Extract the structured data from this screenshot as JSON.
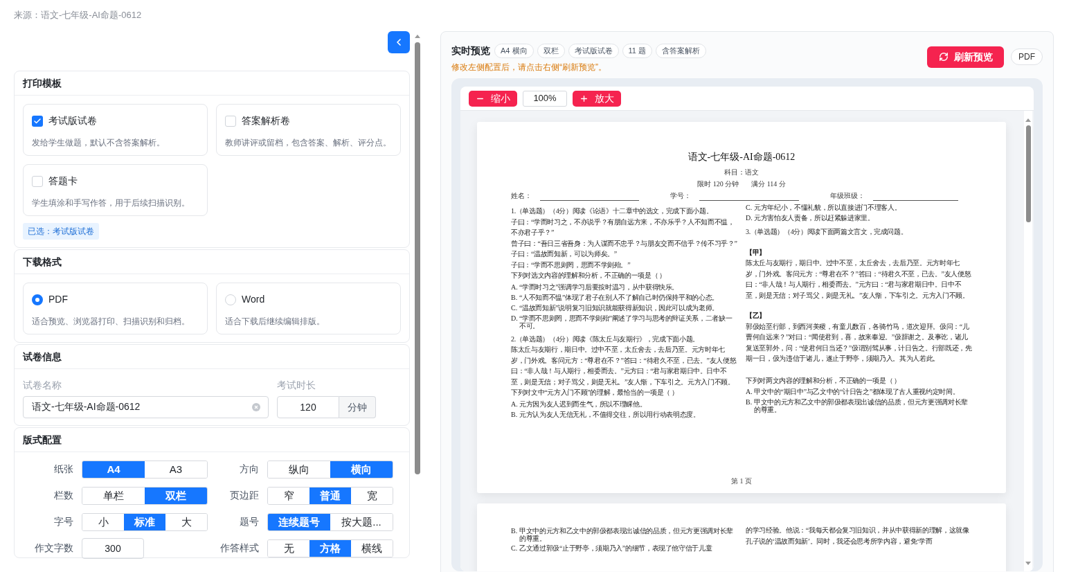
{
  "source": "来源：语文-七年级-AI命题-0612",
  "template": {
    "title": "打印模板",
    "options": [
      {
        "label": "考试版试卷",
        "desc": "发给学生做题，默认不含答案解析。",
        "checked": true
      },
      {
        "label": "答案解析卷",
        "desc": "教师讲评或留档，包含答案、解析、评分点。",
        "checked": false
      },
      {
        "label": "答题卡",
        "desc": "学生填涂和手写作答，用于后续扫描识别。",
        "checked": false
      }
    ],
    "note": "已选：考试版试卷"
  },
  "format": {
    "title": "下载格式",
    "options": [
      {
        "label": "PDF",
        "desc": "适合预览、浏览器打印、扫描识别和归档。",
        "selected": true
      },
      {
        "label": "Word",
        "desc": "适合下载后继续编辑排版。",
        "selected": false
      }
    ]
  },
  "info": {
    "title": "试卷信息",
    "name_label": "试卷名称",
    "name_value": "语文-七年级-AI命题-0612",
    "duration_label": "考试时长",
    "duration_value": "120",
    "duration_unit": "分钟"
  },
  "layout": {
    "title": "版式配置",
    "rows": [
      {
        "label": "纸张",
        "kind": "segmented",
        "options": [
          {
            "label": "A4",
            "selected": true
          },
          {
            "label": "A3",
            "selected": false
          }
        ]
      },
      {
        "label": "方向",
        "kind": "segmented",
        "options": [
          {
            "label": "纵向",
            "selected": false
          },
          {
            "label": "横向",
            "selected": true
          }
        ]
      },
      {
        "label": "栏数",
        "kind": "segmented",
        "options": [
          {
            "label": "单栏",
            "selected": false
          },
          {
            "label": "双栏",
            "selected": true
          }
        ]
      },
      {
        "label": "页边距",
        "kind": "segmented",
        "options": [
          {
            "label": "窄",
            "selected": false
          },
          {
            "label": "普通",
            "selected": true
          },
          {
            "label": "宽",
            "selected": false
          }
        ]
      },
      {
        "label": "字号",
        "kind": "segmented",
        "options": [
          {
            "label": "小",
            "selected": false
          },
          {
            "label": "标准",
            "selected": true
          },
          {
            "label": "大",
            "selected": false
          }
        ]
      },
      {
        "label": "题号",
        "kind": "segmented",
        "options": [
          {
            "label": "连续题号",
            "selected": true
          },
          {
            "label": "按大题...",
            "selected": false
          }
        ]
      },
      {
        "label": "作文字数",
        "kind": "input",
        "value": "300"
      },
      {
        "label": "作答样式",
        "kind": "segmented",
        "options": [
          {
            "label": "无",
            "selected": false
          },
          {
            "label": "方格",
            "selected": true
          },
          {
            "label": "横线",
            "selected": false
          }
        ]
      }
    ]
  },
  "preview": {
    "title": "实时预览",
    "chips": [
      "A4 横向",
      "双栏",
      "考试版试卷",
      "11 题",
      "含答案解析"
    ],
    "hint": "修改左侧配置后，请点击右侧“刷新预览”。",
    "refresh": "刷新预览",
    "pdf": "PDF",
    "zoom_out": "缩小",
    "zoom_value": "100%",
    "zoom_in": "放大",
    "pages": [
      {
        "title": "语文-七年级-AI命题-0612",
        "subject": "科目：语文",
        "time": "限时 120 分钟",
        "score": "满分 114 分",
        "fields": [
          "姓名：",
          "学号：",
          "年级班级："
        ],
        "footer": "第 1 页",
        "columns": [
          [
            {
              "kind": "question",
              "text": "1.（单选题）（4分）阅读《论语》十二章中的选文，完成下面小题。"
            },
            {
              "kind": "line",
              "text": "子曰：“学而时习之，不亦说乎？有朋自远方来，不亦乐乎？人不知而不愠，不亦君子乎？”"
            },
            {
              "kind": "line",
              "text": "曾子曰：“吾日三省吾身：为人谋而不忠乎？与朋友交而不信乎？传不习乎？”"
            },
            {
              "kind": "line",
              "text": "子曰：“温故而知新，可以为师矣。”"
            },
            {
              "kind": "line",
              "text": "子曰：“学而不思则罔，思而不学则殆。”"
            },
            {
              "kind": "line",
              "text": "下列对选文内容的理解和分析，不正确的一项是（ ）"
            },
            {
              "kind": "choice",
              "mark": "A.",
              "text": "“学而时习之”强调学习后要按时温习，从中获得快乐。"
            },
            {
              "kind": "choice",
              "mark": "B.",
              "text": "“人不知而不愠”体现了君子在别人不了解自己时仍保持平和的心态。"
            },
            {
              "kind": "choice",
              "mark": "C.",
              "text": "“温故而知新”说明复习旧知识就能获得新知识，因此可以成为老师。"
            },
            {
              "kind": "choice",
              "mark": "D.",
              "text": "“学而不思则罔，思而不学则殆”阐述了学习与思考的辩证关系，二者缺一不可。"
            },
            {
              "kind": "question",
              "text": "2.（单选题）（4分）阅读《陈太丘与友期行》，完成下面小题。"
            },
            {
              "kind": "line",
              "text": "陈太丘与友期行，期日中。过中不至，太丘舍去，去后乃至。元方时年七岁，门外戏。客问元方：“尊君在不？”答曰：“待君久不至，已去。”友人便怒曰：“非人哉！与人期行，相委而去。”元方曰：“君与家君期日中。日中不至，则是无信；对子骂父，则是无礼。”友人惭，下车引之。元方入门不顾。"
            },
            {
              "kind": "line",
              "text": "下列对文中“元方入门不顾”的理解，最恰当的一项是（ ）"
            },
            {
              "kind": "choice",
              "mark": "A.",
              "text": "元方因为友人迟到而生气，所以不理睬他。"
            },
            {
              "kind": "choice",
              "mark": "B.",
              "text": "元方认为友人无信无礼，不值得交往，所以用行动表明态度。"
            }
          ],
          [
            {
              "kind": "choice",
              "mark": "C.",
              "text": "元方年纪小，不懂礼貌，所以直接进门不理客人。"
            },
            {
              "kind": "choice",
              "mark": "D.",
              "text": "元方害怕友人责备，所以赶紧躲进家里。"
            },
            {
              "kind": "question",
              "text": "3.（单选题）（4分）阅读下面两篇文言文，完成问题。"
            },
            {
              "kind": "label",
              "text": "【甲】"
            },
            {
              "kind": "line",
              "text": "陈太丘与友期行，期日中。过中不至，太丘舍去，去后乃至。元方时年七岁，门外戏。客问元方：“尊君在不？”答曰：“待君久不至，已去。”友人便怒曰：“非人哉！与人期行，相委而去。”元方曰：“君与家君期日中。日中不至，则是无信；对子骂父，则是无礼。”友人惭，下车引之。元方入门不顾。"
            },
            {
              "kind": "label",
              "text": "【乙】"
            },
            {
              "kind": "line",
              "text": "郭伋始至行部，到西河美稷，有童儿数百，各骑竹马，道次迎拜。伋问：“儿曹何自远来？”对曰：“闻使君到，喜，故来奉迎。”伋辞谢之。及事讫，诸儿复送至郭外，问：“使君何日当还？”伋谓别驾从事，计日告之。行部既还，先期一日，伋为违信于诸儿，遂止于野亭，须期乃入。其为人若此。"
            },
            {
              "kind": "prompt",
              "text": "下列对两文内容的理解和分析，不正确的一项是（ ）"
            },
            {
              "kind": "choice",
              "mark": "A.",
              "text": "甲文中的“期日中”与乙文中的“计日告之”都体现了古人重视约定时间。"
            },
            {
              "kind": "choice",
              "mark": "B.",
              "text": "甲文中的元方和乙文中的郭伋都表现出诚信的品质，但元方更强调对长辈的尊重。"
            }
          ]
        ]
      },
      {
        "columns": [
          [
            {
              "kind": "choice",
              "mark": "B.",
              "text": "甲文中的元方和乙文中的郭伋都表现出诚信的品质，但元方更强调对长辈的尊重。"
            },
            {
              "kind": "choice",
              "mark": "C.",
              "text": "乙文通过郭伋“止于野亭，须期乃入”的细节，表现了他守信于儿童"
            }
          ],
          [
            {
              "kind": "line",
              "text": "的学习经验。他说：“我每天都会复习旧知识，并从中获得新的理解，这就像孔子说的‘温故而知新’。同时，我还会思考所学内容，避免‘学而"
            }
          ]
        ]
      }
    ]
  }
}
